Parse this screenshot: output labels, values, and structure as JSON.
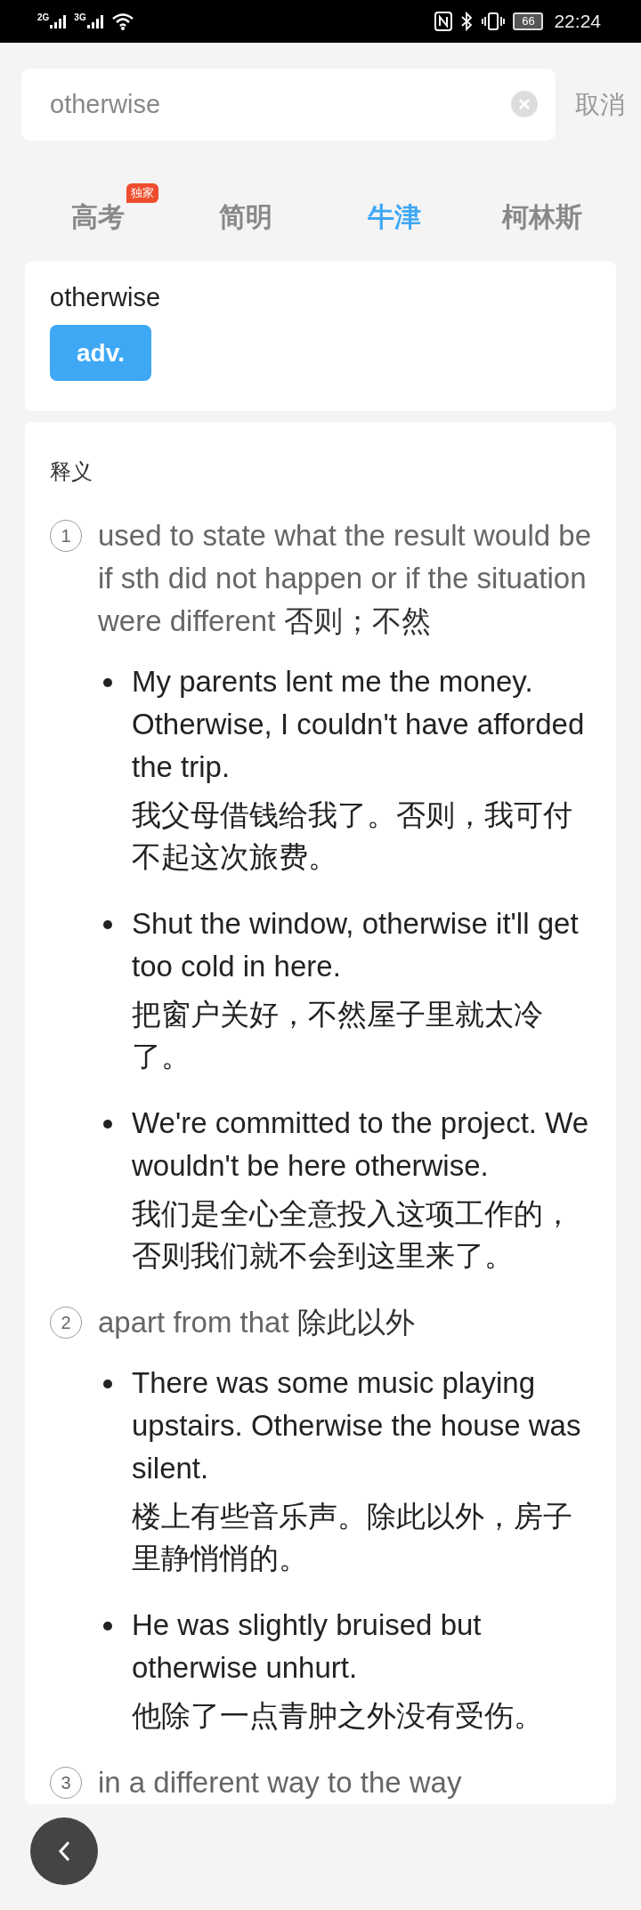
{
  "status_bar": {
    "network_1": "2G",
    "network_2": "3G",
    "battery": "66",
    "time": "22:24"
  },
  "search": {
    "value": "otherwise",
    "cancel": "取消"
  },
  "tabs": [
    {
      "label": "高考",
      "badge": "独家",
      "selected": false
    },
    {
      "label": "简明",
      "selected": false
    },
    {
      "label": "牛津",
      "selected": true
    },
    {
      "label": "柯林斯",
      "selected": false
    }
  ],
  "entry": {
    "word": "otherwise",
    "part_of_speech": "adv."
  },
  "section_title": "释义",
  "senses": [
    {
      "number": "1",
      "definition": "used to state what the result would be if sth did not happen or if the situation were different",
      "translation": "否则；不然",
      "examples": [
        {
          "en": "My parents lent me the money. Otherwise, I couldn't have afforded the trip.",
          "zh": "我父母借钱给我了。否则，我可付不起这次旅费。"
        },
        {
          "en": "Shut the window, otherwise it'll get too cold in here.",
          "zh": "把窗户关好，不然屋子里就太冷了。"
        },
        {
          "en": "We're committed to the project. We wouldn't be here otherwise.",
          "zh": "我们是全心全意投入这项工作的，否则我们就不会到这里来了。"
        }
      ]
    },
    {
      "number": "2",
      "definition": "apart from that",
      "translation": "除此以外",
      "examples": [
        {
          "en": "There was some music playing upstairs. Otherwise the house was silent.",
          "zh": "楼上有些音乐声。除此以外，房子里静悄悄的。"
        },
        {
          "en": "He was slightly bruised but otherwise unhurt.",
          "zh": "他除了一点青肿之外没有受伤。"
        }
      ]
    },
    {
      "number": "3",
      "definition": "in a different way to the way"
    }
  ]
}
